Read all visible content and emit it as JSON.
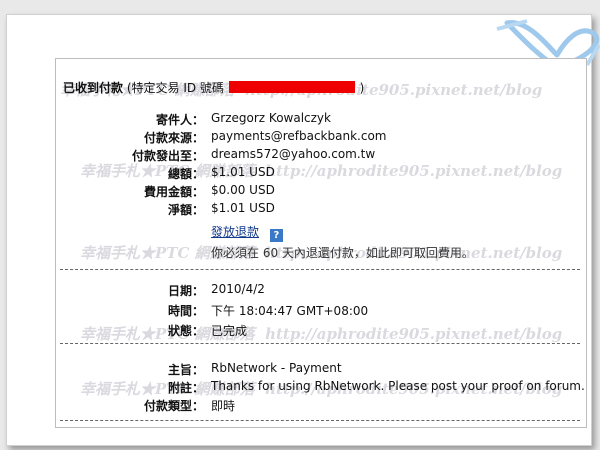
{
  "header": {
    "title": "已收到付款",
    "id_label": "(特定交易 ID 號碼",
    "id_close": ")"
  },
  "sender": {
    "from_label": "寄件人：",
    "from_value": "Grzegorz Kowalczyk",
    "source_label": "付款來源：",
    "source_value": "payments@refbackbank.com",
    "to_label": "付款發出至：",
    "to_value": "dreams572@yahoo.com.tw"
  },
  "amounts": {
    "total_label": "總額：",
    "total_value": "$1.01 USD",
    "fee_label": "費用金額：",
    "fee_value": "$0.00 USD",
    "net_label": "淨額：",
    "net_value": "$1.01 USD",
    "refund_link": "發放退款",
    "help_icon": "?",
    "refund_note": "你必須在 60 天內退還付款，如此即可取回費用。"
  },
  "timing": {
    "date_label": "日期：",
    "date_value": "2010/4/2",
    "time_label": "時間：",
    "time_value": "下午 18:04:47 GMT+08:00",
    "status_label": "狀態：",
    "status_value": "已完成"
  },
  "details": {
    "subject_label": "主旨：",
    "subject_value": "RbNetwork - Payment",
    "note_label": "附註：",
    "note_value": "Thanks for using RbNetwork. Please post your proof on forum.",
    "type_label": "付款類型：",
    "type_value": "即時"
  },
  "watermark": {
    "blog_name": "幸福手札★PTC 網賺部落",
    "blog_url": "http://aphrodite905.pixnet.net/blog"
  },
  "icons": {
    "ribbon": "heart-ribbon-icon",
    "help": "help-icon"
  },
  "colors": {
    "redaction": "#ee0000",
    "link": "#123a8c",
    "help_badge": "#3a79c8",
    "ribbon": "#9ec8ec"
  }
}
